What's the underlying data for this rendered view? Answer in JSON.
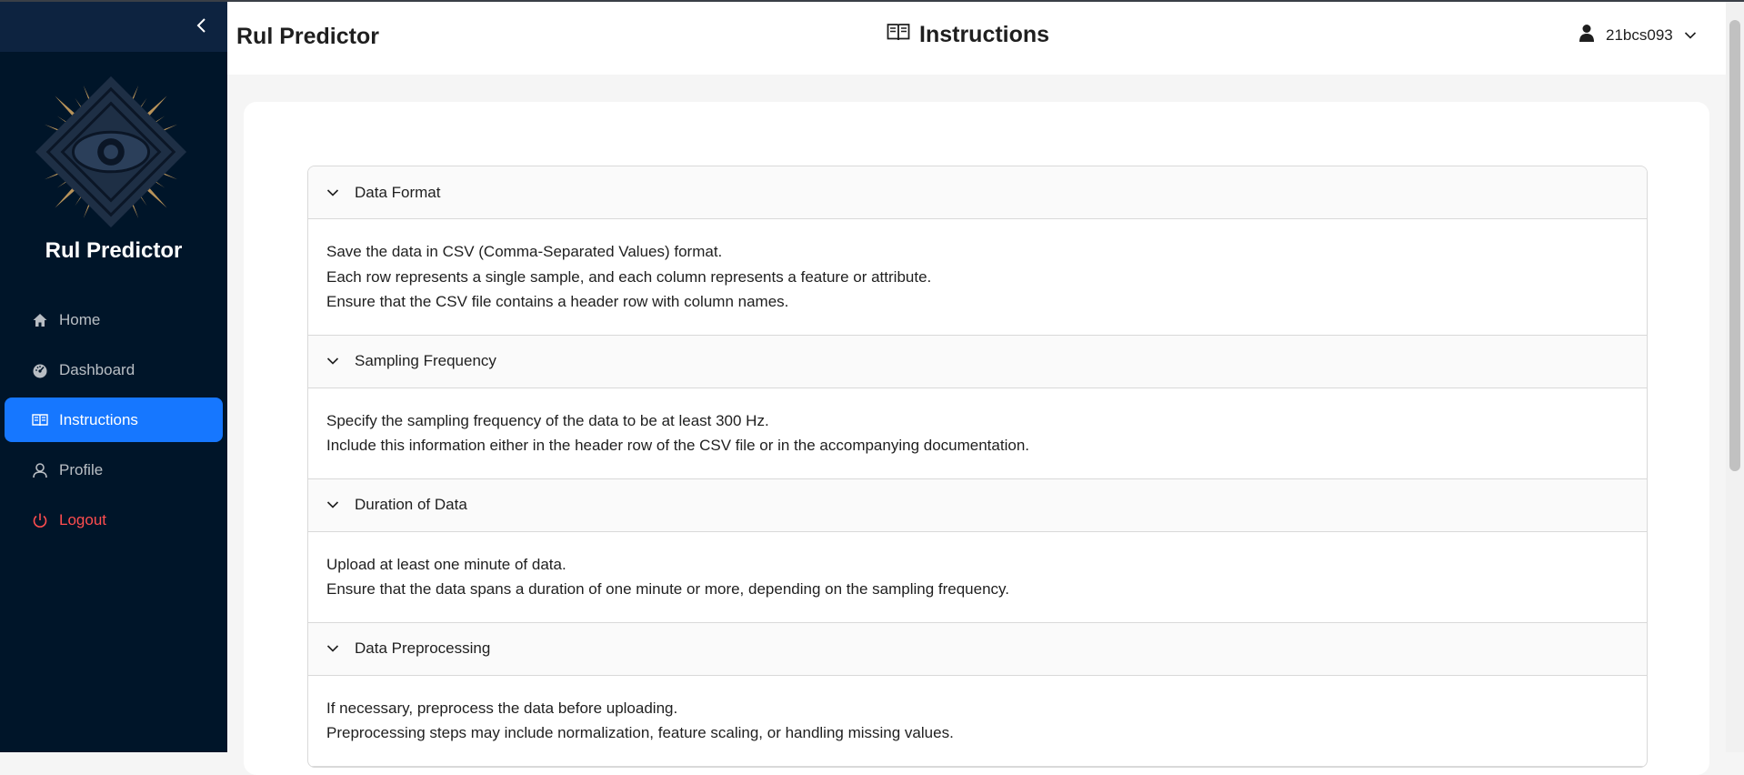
{
  "sidebar": {
    "brand": "Rul Predictor",
    "collapse_icon": "chevron-left-icon",
    "items": [
      {
        "label": "Home",
        "icon": "home-icon"
      },
      {
        "label": "Dashboard",
        "icon": "dashboard-icon"
      },
      {
        "label": "Instructions",
        "icon": "book-icon",
        "active": true
      },
      {
        "label": "Profile",
        "icon": "user-icon"
      },
      {
        "label": "Logout",
        "icon": "power-icon"
      }
    ]
  },
  "header": {
    "app_title": "Rul Predictor",
    "page_title": "Instructions",
    "page_icon": "book-icon",
    "username": "21bcs093"
  },
  "sections": [
    {
      "title": "Data Format",
      "lines": [
        "Save the data in CSV (Comma-Separated Values) format.",
        "Each row represents a single sample, and each column represents a feature or attribute.",
        "Ensure that the CSV file contains a header row with column names."
      ]
    },
    {
      "title": "Sampling Frequency",
      "lines": [
        "Specify the sampling frequency of the data to be at least 300 Hz.",
        "Include this information either in the header row of the CSV file or in the accompanying documentation."
      ]
    },
    {
      "title": "Duration of Data",
      "lines": [
        "Upload at least one minute of data.",
        "Ensure that the data spans a duration of one minute or more, depending on the sampling frequency."
      ]
    },
    {
      "title": "Data Preprocessing",
      "lines": [
        "If necessary, preprocess the data before uploading.",
        "Preprocessing steps may include normalization, feature scaling, or handling missing values."
      ]
    }
  ],
  "colors": {
    "sidebar_bg": "#001529",
    "accent": "#1677ff",
    "danger": "#ff4d4f",
    "logo_gold": "#b8935a",
    "logo_dark": "#1e2f45"
  }
}
